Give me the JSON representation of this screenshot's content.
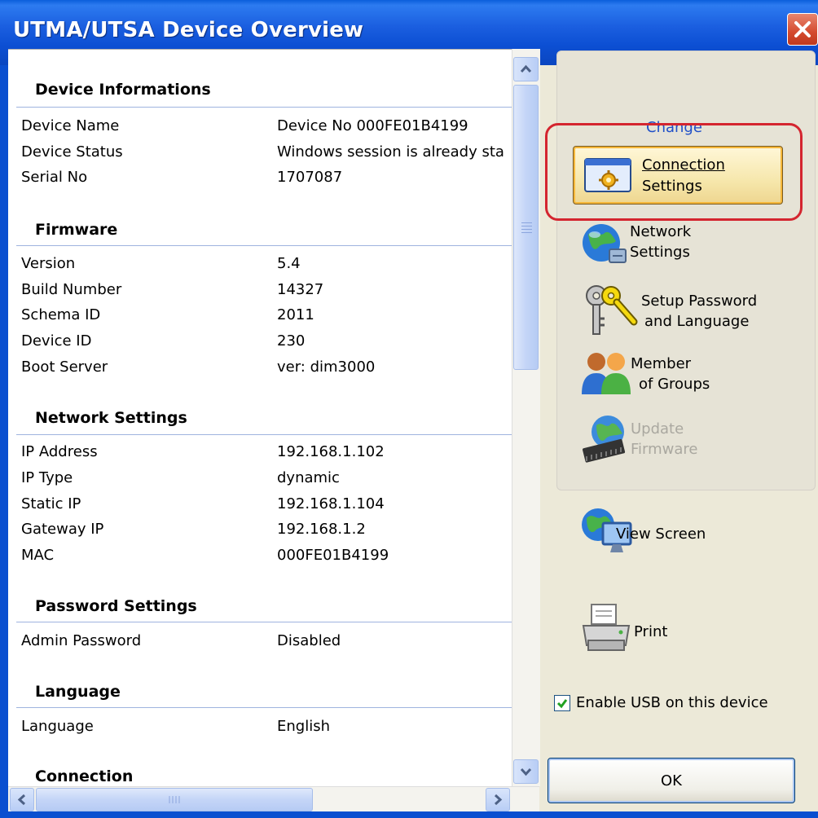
{
  "window": {
    "title": "UTMA/UTSA Device Overview"
  },
  "sections": [
    {
      "heading": "Device Informations",
      "rows": [
        {
          "label": "Device Name",
          "value": "Device No  000FE01B4199"
        },
        {
          "label": "Device Status",
          "value": "Windows session is already sta"
        },
        {
          "label": "Serial No",
          "value": "1707087"
        }
      ]
    },
    {
      "heading": "Firmware",
      "rows": [
        {
          "label": "Version",
          "value": "5.4"
        },
        {
          "label": "Build Number",
          "value": "14327"
        },
        {
          "label": "Schema ID",
          "value": "2011"
        },
        {
          "label": "Device ID",
          "value": "230"
        },
        {
          "label": "Boot Server",
          "value": "ver: dim3000"
        }
      ]
    },
    {
      "heading": "Network Settings",
      "rows": [
        {
          "label": "IP Address",
          "value": "192.168.1.102"
        },
        {
          "label": "IP Type",
          "value": "dynamic"
        },
        {
          "label": "Static IP",
          "value": "192.168.1.104"
        },
        {
          "label": "Gateway IP",
          "value": "192.168.1.2"
        },
        {
          "label": "MAC",
          "value": "000FE01B4199"
        }
      ]
    },
    {
      "heading": "Password Settings",
      "rows": [
        {
          "label": "Admin Password",
          "value": "Disabled"
        }
      ]
    },
    {
      "heading": "Language",
      "rows": [
        {
          "label": "Language",
          "value": "English"
        }
      ]
    },
    {
      "heading": "Connection",
      "rows": []
    }
  ],
  "actions": {
    "group_title": "Change",
    "connection_settings": {
      "line1": "Connection",
      "line2": "Settings",
      "icon": "gear-window-icon"
    },
    "network_settings": {
      "line1": "Network",
      "line2": "Settings",
      "icon": "globe-network-icon"
    },
    "setup_password": {
      "line1": "Setup Password",
      "line2": "and Language",
      "icon": "keys-icon"
    },
    "member_groups": {
      "line1": "Member",
      "line2": "of Groups",
      "icon": "users-group-icon"
    },
    "update_firmware": {
      "line1": "Update",
      "line2": "Firmware",
      "icon": "chip-globe-icon",
      "disabled": true
    },
    "view_screen": {
      "label": "View Screen",
      "icon": "monitor-globe-icon"
    },
    "print": {
      "label": "Print",
      "icon": "printer-icon"
    }
  },
  "usb": {
    "label": "Enable USB on this device",
    "checked": true
  },
  "ok_button": {
    "label": "OK"
  },
  "colors": {
    "title_bar": "#0a5edb",
    "link_blue": "#1f4fc8",
    "highlight_red": "#d4252f",
    "panel_bg": "#ece9d8"
  }
}
